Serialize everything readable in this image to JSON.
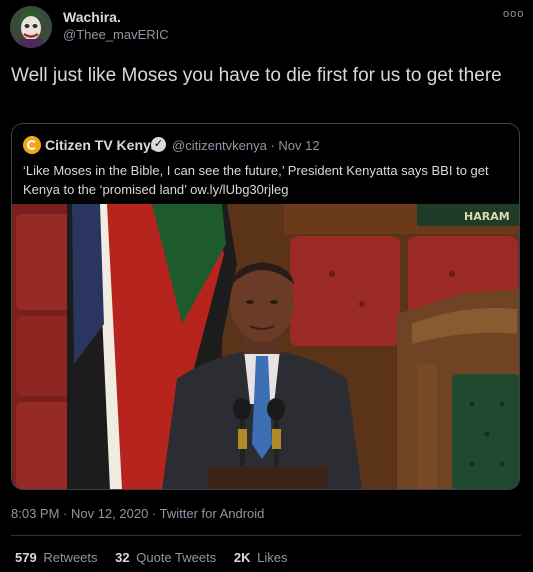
{
  "author": {
    "display_name": "Wachira.",
    "handle": "@Thee_mavERIC",
    "avatar_icon": "joker-avatar"
  },
  "more_icon": "ooo",
  "tweet": {
    "text": "Well just like Moses you have to die first for us to get there"
  },
  "quoted": {
    "display_name": "Citizen TV Kenya",
    "verified_icon": "verified-badge-icon",
    "handle_time": "@citizentvkenya · Nov 12",
    "text": "‘Like Moses in the Bible, I can see the future,’ President Kenyatta says BBI to get Kenya to the ‘promised land’ ow.ly/lUbg30rjleg",
    "image_caption_sign": "HARAM"
  },
  "meta": {
    "timestamp": "8:03 PM · Nov 12, 2020 · Twitter for Android"
  },
  "stats": {
    "retweets_count": "579",
    "retweets_label": "Retweets",
    "quotes_count": "32",
    "quotes_label": "Quote Tweets",
    "likes_count": "2K",
    "likes_label": "Likes"
  },
  "colors": {
    "background": "#000000",
    "text": "#d9d9d9",
    "muted": "#8b98a5",
    "border": "#3d4247"
  }
}
